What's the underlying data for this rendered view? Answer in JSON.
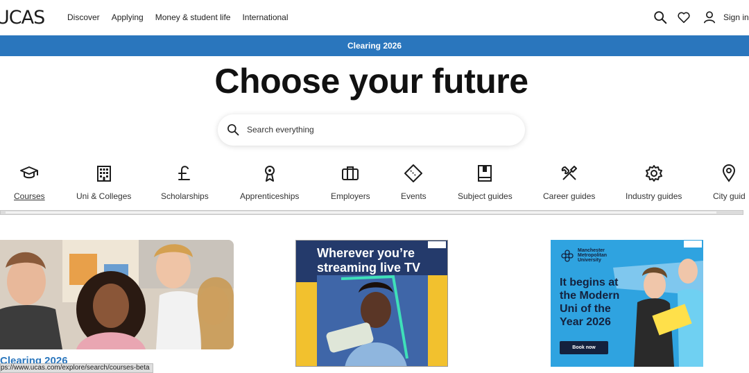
{
  "header": {
    "logo": "UCAS",
    "nav": [
      "Discover",
      "Applying",
      "Money & student life",
      "International"
    ],
    "sign_in": "Sign in"
  },
  "banner": {
    "label": "Clearing 2026",
    "color": "#2a76bd"
  },
  "hero": {
    "title": "Choose your future"
  },
  "search": {
    "placeholder": "Search everything"
  },
  "categories": [
    {
      "label": "Courses",
      "icon": "graduation-cap-icon",
      "active": true
    },
    {
      "label": "Uni & Colleges",
      "icon": "building-icon"
    },
    {
      "label": "Scholarships",
      "icon": "pound-icon"
    },
    {
      "label": "Apprenticeships",
      "icon": "rosette-icon"
    },
    {
      "label": "Employers",
      "icon": "briefcase-icon"
    },
    {
      "label": "Events",
      "icon": "ticket-icon"
    },
    {
      "label": "Subject guides",
      "icon": "book-icon"
    },
    {
      "label": "Career guides",
      "icon": "tools-icon"
    },
    {
      "label": "Industry guides",
      "icon": "gear-icon"
    },
    {
      "label": "City guid",
      "icon": "map-pin-icon"
    }
  ],
  "cards": {
    "feature_title": "Clearing 2026"
  },
  "ads": {
    "ad1_headline": "Wherever you’re streaming live TV",
    "ad2_brand": "Manchester Metropolitan University",
    "ad2_headline": "It begins at the Modern Uni of the Year 2026",
    "ad2_cta": "Book now"
  },
  "status_url": "ps://www.ucas.com/explore/search/courses-beta"
}
